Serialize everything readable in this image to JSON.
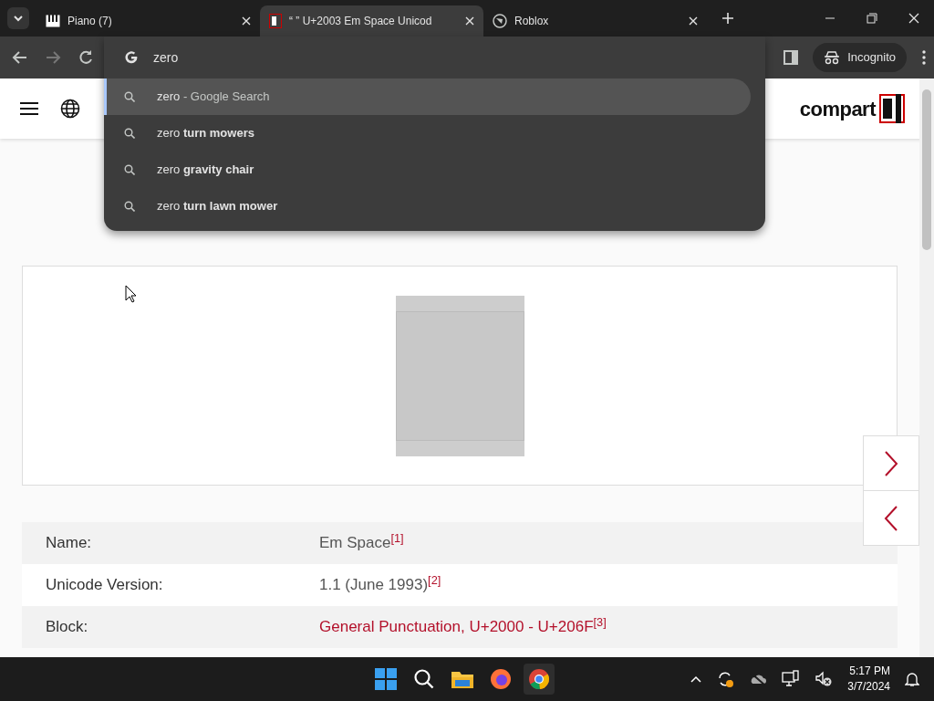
{
  "tabs": [
    {
      "title": "Piano (7)",
      "selected": false
    },
    {
      "title": "“  ” U+2003 Em Space Unicod",
      "selected": true
    },
    {
      "title": "Roblox",
      "selected": false
    }
  ],
  "omnibox": {
    "value": "zero"
  },
  "incognito": "Incognito",
  "suggestions": [
    {
      "query": "zero",
      "suffix": "- Google Search",
      "selected": true
    },
    {
      "text": "zero **turn mowers**",
      "selected": false
    },
    {
      "text": "zero **gravity chair**",
      "selected": false
    },
    {
      "text": "zero **turn lawn mower**",
      "selected": false
    }
  ],
  "logo": "compart",
  "properties": [
    {
      "label": "Name:",
      "value": "Em Space$^{[1]}$",
      "kind": "text"
    },
    {
      "label": "Unicode Version:",
      "value": "1.1 (June 1993)$^{[2]}$",
      "kind": "text"
    },
    {
      "label": "Block:",
      "value": "General Punctuation, U+2000 - U+206F$^{[3]}$",
      "kind": "link"
    }
  ],
  "clock": {
    "time": "5:17 PM",
    "date": "3/7/2024"
  }
}
